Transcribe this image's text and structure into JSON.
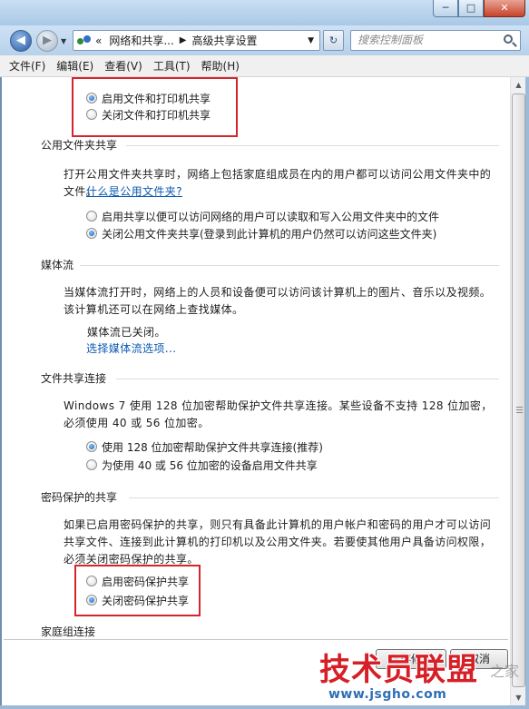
{
  "window": {
    "minimize": "─",
    "maximize": "□",
    "close": "✕"
  },
  "nav": {
    "back_icon": "back-arrow-icon",
    "forward_icon": "forward-arrow-icon",
    "address": {
      "overflow": "«",
      "crumbs": [
        "网络和共享...",
        "高级共享设置"
      ]
    },
    "search_placeholder": "搜索控制面板"
  },
  "menu": [
    "文件(F)",
    "编辑(E)",
    "查看(V)",
    "工具(T)",
    "帮助(H)"
  ],
  "file_printer_sharing": {
    "options": [
      {
        "label": "启用文件和打印机共享",
        "selected": true
      },
      {
        "label": "关闭文件和打印机共享",
        "selected": false
      }
    ]
  },
  "public_folder": {
    "title": "公用文件夹共享",
    "description": "打开公用文件夹共享时，网络上包括家庭组成员在内的用户都可以访问公用文件夹中的文件。",
    "link": "什么是公用文件夹?",
    "options": [
      {
        "label": "启用共享以便可以访问网络的用户可以读取和写入公用文件夹中的文件",
        "selected": false
      },
      {
        "label": "关闭公用文件夹共享(登录到此计算机的用户仍然可以访问这些文件夹)",
        "selected": true
      }
    ]
  },
  "media": {
    "title": "媒体流",
    "description": "当媒体流打开时，网络上的人员和设备便可以访问该计算机上的图片、音乐以及视频。该计算机还可以在网络上查找媒体。",
    "status": "媒体流已关闭。",
    "link": "选择媒体流选项..."
  },
  "file_sharing_connection": {
    "title": "文件共享连接",
    "description": "Windows 7 使用 128 位加密帮助保护文件共享连接。某些设备不支持 128 位加密，必须使用 40 或 56 位加密。",
    "options": [
      {
        "label": "使用 128 位加密帮助保护文件共享连接(推荐)",
        "selected": true
      },
      {
        "label": "为使用 40 或 56 位加密的设备启用文件共享",
        "selected": false
      }
    ]
  },
  "password_sharing": {
    "title": "密码保护的共享",
    "description": "如果已启用密码保护的共享，则只有具备此计算机的用户帐户和密码的用户才可以访问共享文件、连接到此计算机的打印机以及公用文件夹。若要使其他用户具备访问权限，必须关闭密码保护的共享。",
    "options": [
      {
        "label": "启用密码保护共享",
        "selected": false
      },
      {
        "label": "关闭密码保护共享",
        "selected": true
      }
    ]
  },
  "homegroup": {
    "title": "家庭组连接"
  },
  "buttons": {
    "save": "保存修改",
    "cancel": "取消"
  },
  "watermark": {
    "main": "技术员联盟",
    "side": "之家",
    "url": "www.jsgho.com"
  },
  "colors": {
    "highlight_box": "#d6242b",
    "link": "#0b59b3"
  }
}
